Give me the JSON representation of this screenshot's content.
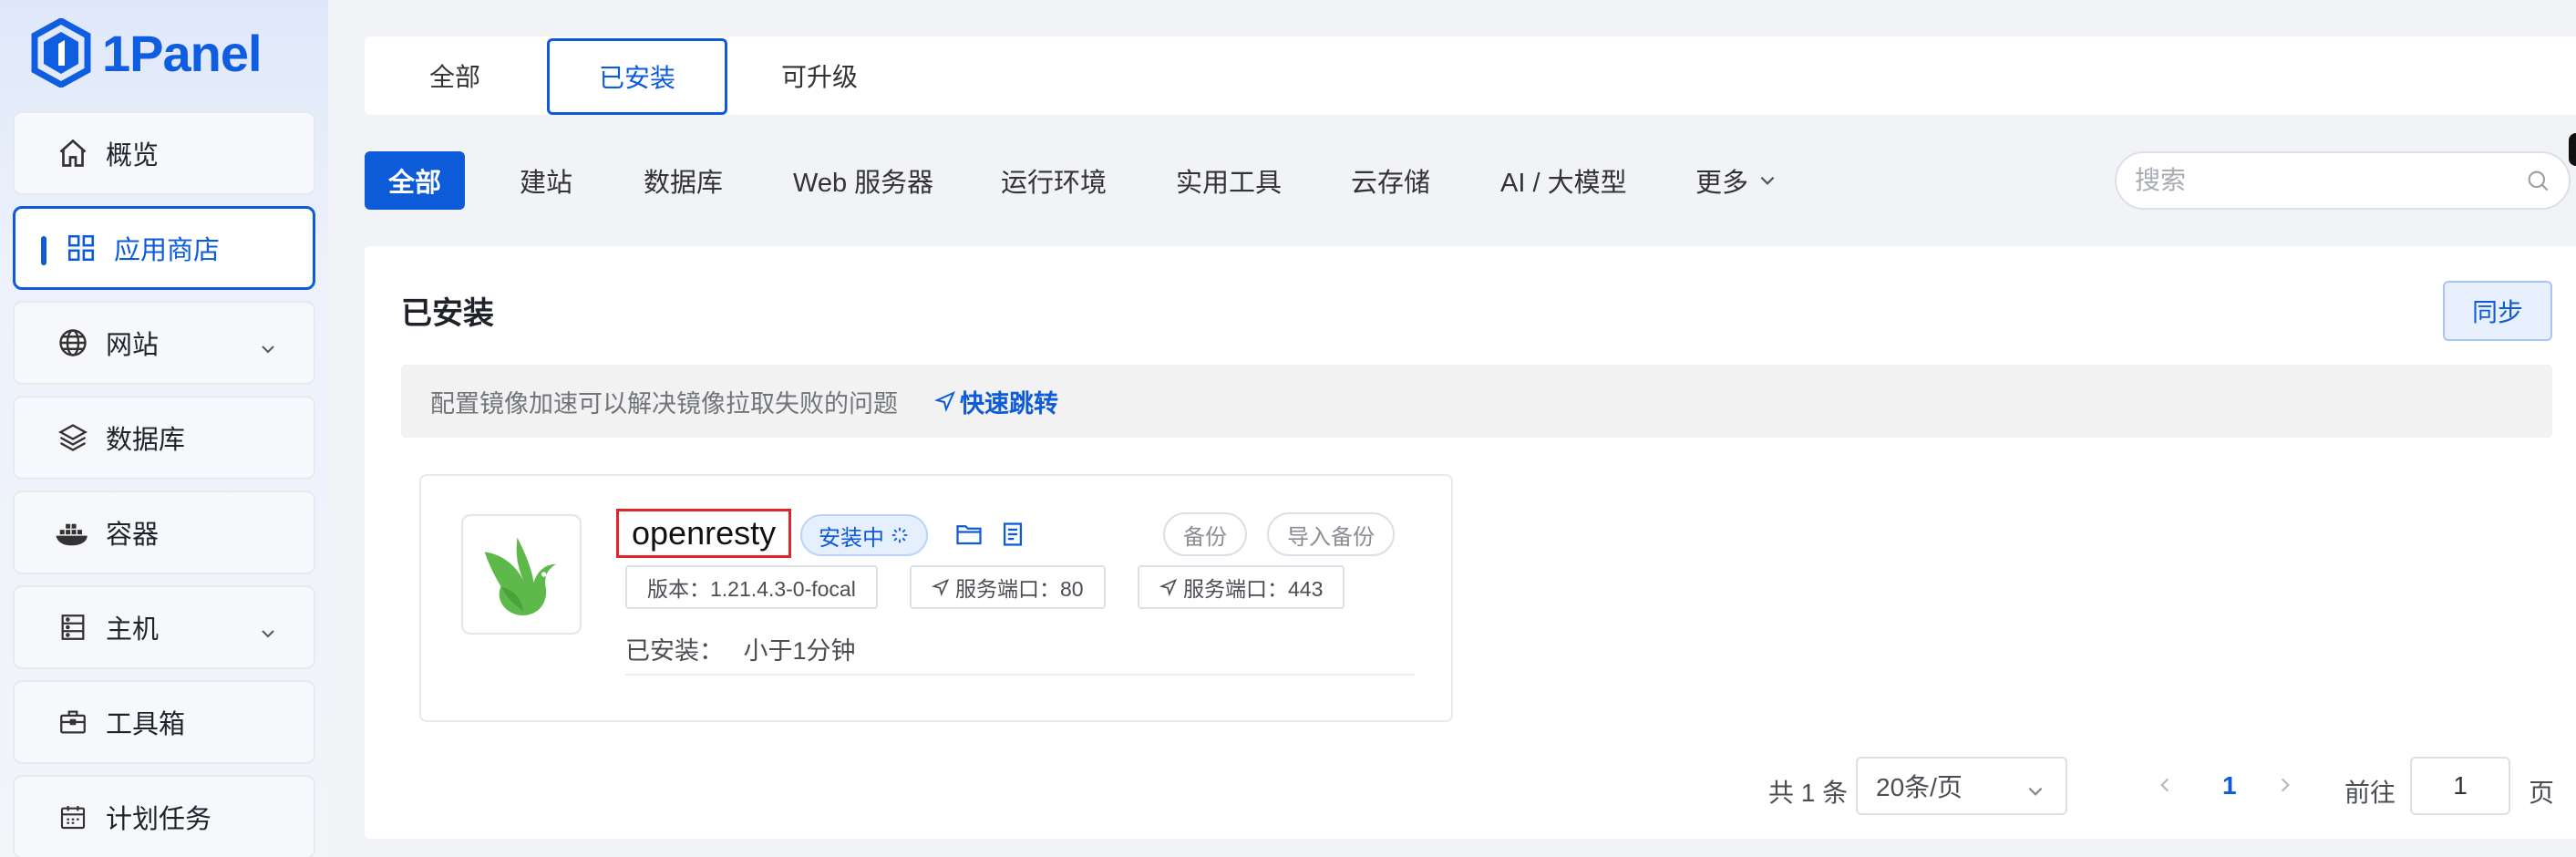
{
  "brand": {
    "name": "1Panel",
    "color": "#0f5de0"
  },
  "sidebar": {
    "items": [
      {
        "label": "概览",
        "icon": "home-icon",
        "active": false,
        "expandable": false
      },
      {
        "label": "应用商店",
        "icon": "apps-grid-icon",
        "active": true,
        "expandable": false
      },
      {
        "label": "网站",
        "icon": "globe-icon",
        "active": false,
        "expandable": true
      },
      {
        "label": "数据库",
        "icon": "layers-icon",
        "active": false,
        "expandable": false
      },
      {
        "label": "容器",
        "icon": "docker-icon",
        "active": false,
        "expandable": false
      },
      {
        "label": "主机",
        "icon": "server-icon",
        "active": false,
        "expandable": true
      },
      {
        "label": "工具箱",
        "icon": "toolbox-icon",
        "active": false,
        "expandable": false
      },
      {
        "label": "计划任务",
        "icon": "calendar-icon",
        "active": false,
        "expandable": false
      }
    ]
  },
  "top_tabs": [
    {
      "label": "全部",
      "active": false
    },
    {
      "label": "已安装",
      "active": true
    },
    {
      "label": "可升级",
      "active": false
    }
  ],
  "categories": [
    {
      "label": "全部",
      "active": true
    },
    {
      "label": "建站",
      "active": false
    },
    {
      "label": "数据库",
      "active": false
    },
    {
      "label": "Web 服务器",
      "active": false
    },
    {
      "label": "运行环境",
      "active": false
    },
    {
      "label": "实用工具",
      "active": false
    },
    {
      "label": "云存储",
      "active": false
    },
    {
      "label": "AI / 大模型",
      "active": false
    },
    {
      "label": "更多",
      "active": false
    }
  ],
  "search": {
    "placeholder": "搜索",
    "value": ""
  },
  "panel": {
    "title": "已安装",
    "sync_label": "同步",
    "notice_text": "配置镜像加速可以解决镜像拉取失败的问题",
    "notice_link": "快速跳转"
  },
  "app": {
    "name": "openresty",
    "status": "安装中",
    "backup_label": "备份",
    "import_backup_label": "导入备份",
    "version_tag": "版本：1.21.4.3-0-focal",
    "port_tag_1": "服务端口：80",
    "port_tag_2": "服务端口：443",
    "installed_label": "已安装：",
    "installed_value": "小于1分钟"
  },
  "pagination": {
    "total": "共 1 条",
    "page_size": "20条/页",
    "current_page": "1",
    "goto_label": "前往",
    "goto_value": "1",
    "page_suffix": "页"
  },
  "colors": {
    "primary": "#0d5bd8",
    "highlight_border": "#e0262b"
  }
}
